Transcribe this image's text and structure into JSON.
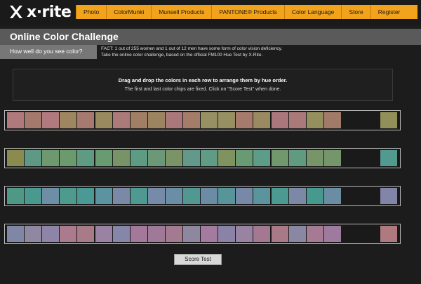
{
  "logo": {
    "text": "x·rite"
  },
  "nav": {
    "items": [
      "Photo",
      "ColorMunki",
      "Munsell Products",
      "PANTONE® Products",
      "Color Language",
      "Store",
      "Register"
    ]
  },
  "header": {
    "title": "Online Color Challenge",
    "subtitle": "How well do you see color?",
    "fact_line1": "FACT: 1 out of 255 women and 1 out of 12 men have some form of color vision deficiency.",
    "fact_line2": "Take the online color challenge, based on the official FM100 Hue Test by X-Rite."
  },
  "instructions": {
    "bold": "Drag and drop the colors in each row to arrange them by hue order.",
    "normal": "The first and last color chips are fixed. Click on \"Score Test\" when done."
  },
  "rows": [
    [
      "#b07a7c",
      "#a57a6c",
      "#b07a7f",
      "#9d8660",
      "#a67a6f",
      "#9a8a60",
      "#ac7a78",
      "#a07f64",
      "#9c8461",
      "#aa787b",
      "#a47c69",
      "#979062",
      "#969063",
      "#a77b6b",
      "#9a8a62",
      "#aa787c",
      "#a97a79",
      "#958f5e",
      "#a17b68",
      "#938f58"
    ],
    [
      "#8c8b4f",
      "#5f9985",
      "#6d9870",
      "#6d9a6d",
      "#5f9a82",
      "#6a9a72",
      "#789466",
      "#5e9b84",
      "#6c9878",
      "#7a9467",
      "#62998a",
      "#5f9b85",
      "#7f9361",
      "#6a9a74",
      "#5d9c88",
      "#71976d",
      "#609a80",
      "#779568",
      "#75966b",
      "#52998f"
    ],
    [
      "#4f9886",
      "#4a998e",
      "#6d8ea4",
      "#4e9a8c",
      "#4b9994",
      "#5b93a0",
      "#7a8aa6",
      "#4e9a90",
      "#768ba7",
      "#6a8ea5",
      "#519893",
      "#6c8ca6",
      "#57959b",
      "#7889a8",
      "#5a949d",
      "#4c9991",
      "#7d88a6",
      "#47998f",
      "#6a8da4",
      "#8186a8"
    ],
    [
      "#7f86a6",
      "#8e88a0",
      "#8d84a7",
      "#ab7a8d",
      "#a97a88",
      "#9a83a2",
      "#8686a8",
      "#a3789b",
      "#9f7a98",
      "#a47a91",
      "#8d87a0",
      "#a37b9e",
      "#8b82a8",
      "#9983a2",
      "#a57892",
      "#a87a86",
      "#8a87a2",
      "#a67a93",
      "#9e7a9f",
      "#af7a7e"
    ]
  ],
  "buttons": {
    "score": "Score Test"
  }
}
